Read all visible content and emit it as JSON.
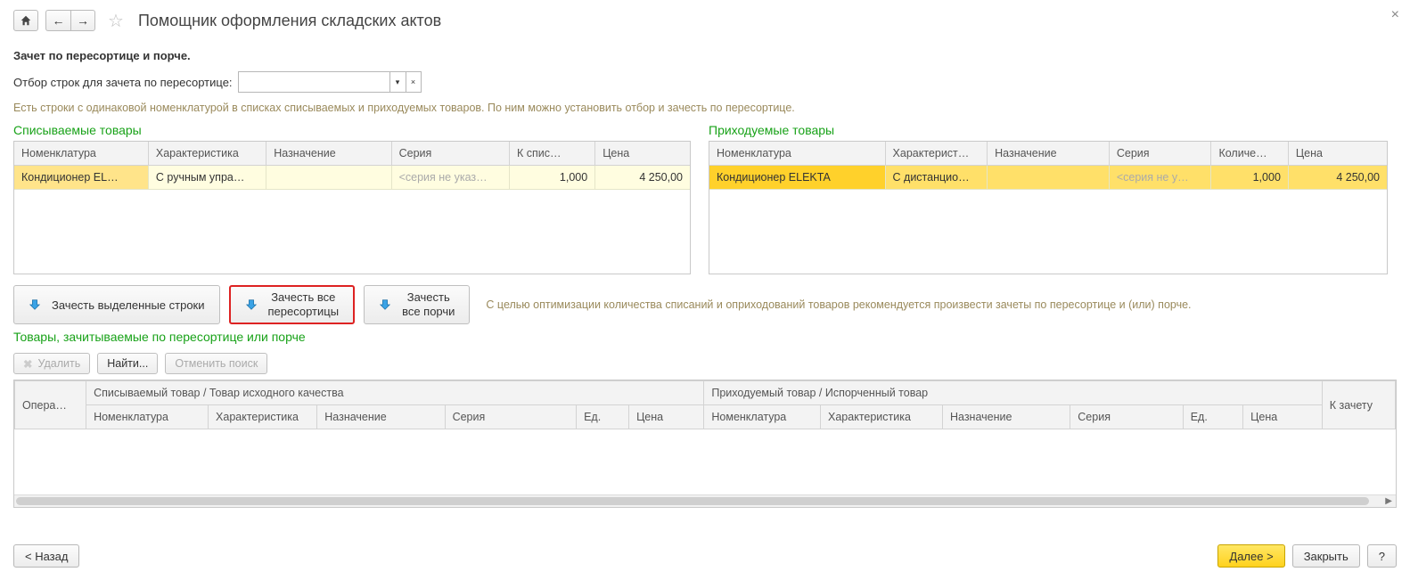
{
  "header": {
    "title": "Помощник оформления складских актов"
  },
  "subtitle": "Зачет по пересортице и порче.",
  "filter": {
    "label": "Отбор строк для зачета по пересортице:",
    "value": ""
  },
  "info_dup": "Есть строки с одинаковой номенклатурой в списках списываемых и приходуемых товаров. По ним можно установить отбор и зачесть по пересортице.",
  "left": {
    "title": "Списываемые товары",
    "cols": [
      "Номенклатура",
      "Характеристика",
      "Назначение",
      "Серия",
      "К спис…",
      "Цена"
    ],
    "rows": [
      {
        "nomen": "Кондиционер EL…",
        "char": "С ручным упра…",
        "assign": "",
        "series": "<серия не указ…",
        "qty": "1,000",
        "price": "4 250,00"
      }
    ]
  },
  "right": {
    "title": "Приходуемые товары",
    "cols": [
      "Номенклатура",
      "Характерист…",
      "Назначение",
      "Серия",
      "Количе…",
      "Цена"
    ],
    "rows": [
      {
        "nomen": "Кондиционер ELEKTA",
        "char": "С дистанцио…",
        "assign": "",
        "series": "<серия не у…",
        "qty": "1,000",
        "price": "4 250,00"
      }
    ]
  },
  "actions": {
    "credit_selected": "Зачесть выделенные строки",
    "credit_all_resort_l1": "Зачесть все",
    "credit_all_resort_l2": "пересортицы",
    "credit_all_spoil_l1": "Зачесть",
    "credit_all_spoil_l2": "все порчи",
    "hint": "С целью оптимизации количества списаний и оприходований товаров рекомендуется произвести зачеты по пересортице и (или) порче."
  },
  "lower": {
    "title": "Товары, зачитываемые по пересортице или порче",
    "delete": "Удалить",
    "find": "Найти...",
    "cancel_find": "Отменить поиск",
    "cols": {
      "oper": "Опера…",
      "group_left": "Списываемый товар / Товар исходного качества",
      "group_right": "Приходуемый товар / Испорченный товар",
      "to_credit": "К зачету",
      "sub": [
        "Номенклатура",
        "Характеристика",
        "Назначение",
        "Серия",
        "Ед.",
        "Цена"
      ]
    }
  },
  "footer": {
    "back": "< Назад",
    "next": "Далее >",
    "close": "Закрыть",
    "help": "?"
  }
}
